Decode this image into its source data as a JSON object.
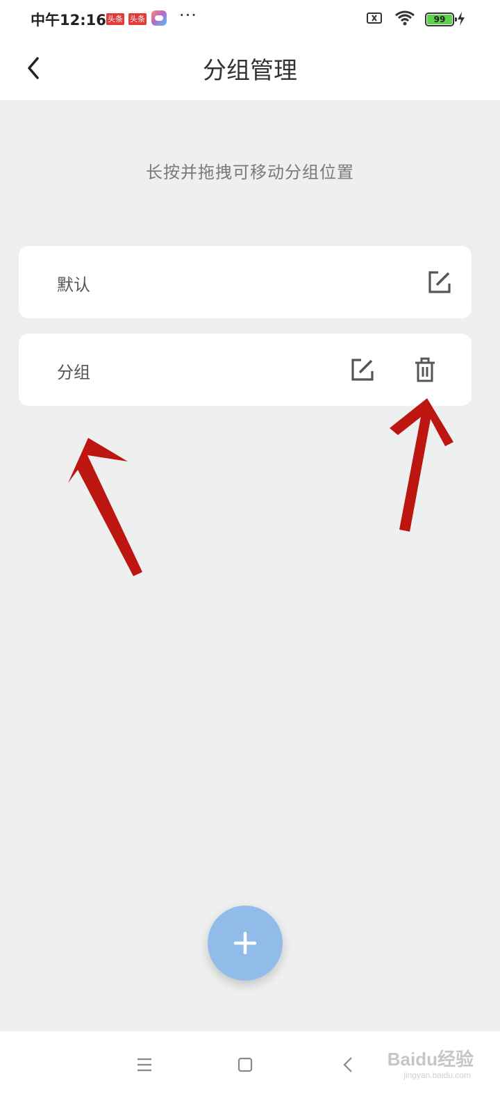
{
  "status_bar": {
    "time": "中午12:16",
    "badges": [
      "头条",
      "头条"
    ],
    "more": "···",
    "battery_level": "99"
  },
  "header": {
    "title": "分组管理"
  },
  "hint": "长按并拖拽可移动分组位置",
  "groups": [
    {
      "label": "默认",
      "actions": [
        "edit"
      ]
    },
    {
      "label": "分组",
      "actions": [
        "edit",
        "delete"
      ]
    }
  ],
  "fab": {
    "icon": "plus-icon"
  },
  "watermark": {
    "brand": "Baidu经验",
    "url": "jingyan.baidu.com"
  },
  "colors": {
    "fab": "#91bce9",
    "annotation_arrow": "#bd1510",
    "background": "#eeefef"
  }
}
